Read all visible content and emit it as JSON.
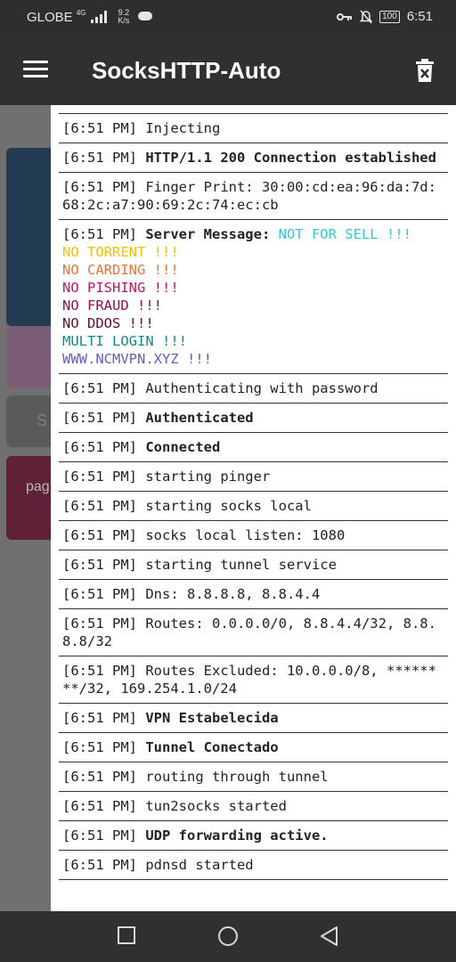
{
  "status_bar": {
    "carrier": "GLOBE",
    "network_type": "4G",
    "speed_value": "9.2",
    "speed_unit": "K/s",
    "battery": "100",
    "time": "6:51"
  },
  "app_bar": {
    "title": "SocksHTTP-Auto",
    "menu_icon": "hamburger-menu-icon",
    "clear_icon": "trash-icon"
  },
  "log": {
    "entries": [
      {
        "time": "[6:51 PM]",
        "text": "Injecting",
        "bold": false
      },
      {
        "time": "[6:51 PM]",
        "text": "HTTP/1.1 200 Connection established",
        "bold": true
      },
      {
        "time": "[6:51 PM]",
        "text": "Finger Print: 30:00:cd:ea:96:da:7d:68:2c:a7:90:69:2c:74:ec:cb",
        "bold": false
      },
      {
        "time": "[6:51 PM]",
        "text": "Server Message:",
        "bold": true,
        "server_message": true
      },
      {
        "time": "[6:51 PM]",
        "text": "Authenticating with password",
        "bold": false
      },
      {
        "time": "[6:51 PM]",
        "text": "Authenticated",
        "bold": true
      },
      {
        "time": "[6:51 PM]",
        "text": "Connected",
        "bold": true
      },
      {
        "time": "[6:51 PM]",
        "text": "starting pinger",
        "bold": false
      },
      {
        "time": "[6:51 PM]",
        "text": "starting socks local",
        "bold": false
      },
      {
        "time": "[6:51 PM]",
        "text": "socks local listen: 1080",
        "bold": false
      },
      {
        "time": "[6:51 PM]",
        "text": "starting tunnel service",
        "bold": false
      },
      {
        "time": "[6:51 PM]",
        "text": "Dns: 8.8.8.8, 8.8.4.4",
        "bold": false
      },
      {
        "time": "[6:51 PM]",
        "text": "Routes: 0.0.0.0/0, 8.8.4.4/32, 8.8.8.8/32",
        "bold": false
      },
      {
        "time": "[6:51 PM]",
        "text": "Routes Excluded: 10.0.0.0/8, ********/32, 169.254.1.0/24",
        "bold": false
      },
      {
        "time": "[6:51 PM]",
        "text": "VPN Estabelecida",
        "bold": true
      },
      {
        "time": "[6:51 PM]",
        "text": "Tunnel Conectado",
        "bold": true
      },
      {
        "time": "[6:51 PM]",
        "text": "routing through tunnel",
        "bold": false
      },
      {
        "time": "[6:51 PM]",
        "text": "tun2socks started",
        "bold": false
      },
      {
        "time": "[6:51 PM]",
        "text": "UDP forwarding active.",
        "bold": true
      },
      {
        "time": "[6:51 PM]",
        "text": "pdnsd started",
        "bold": false
      }
    ],
    "server_message_lines": [
      {
        "text": "NOT FOR SELL !!!",
        "color": "#36c4d6",
        "inline": true
      },
      {
        "text": "NO TORRENT !!!",
        "color": "#f2c200"
      },
      {
        "text": "NO CARDING !!!",
        "color": "#e8743b"
      },
      {
        "text": "NO PISHING !!!",
        "color": "#c2185b"
      },
      {
        "text": "NO FRAUD !!!",
        "color": "#8e1148"
      },
      {
        "text": "NO DDOS !!!",
        "color": "#5a1035"
      },
      {
        "text": "MULTI LOGIN !!!",
        "color": "#128a8a"
      },
      {
        "text": "WWW.NCMVPN.XYZ !!!",
        "color": "#6b5bb5"
      }
    ]
  },
  "background_partial": {
    "button_text_1": "S",
    "button_text_2": "pag"
  },
  "colors": {
    "status_bar": "#2e2e2e",
    "app_bar": "#303030",
    "dim_overlay": "#707070",
    "log_panel": "#ffffff"
  }
}
